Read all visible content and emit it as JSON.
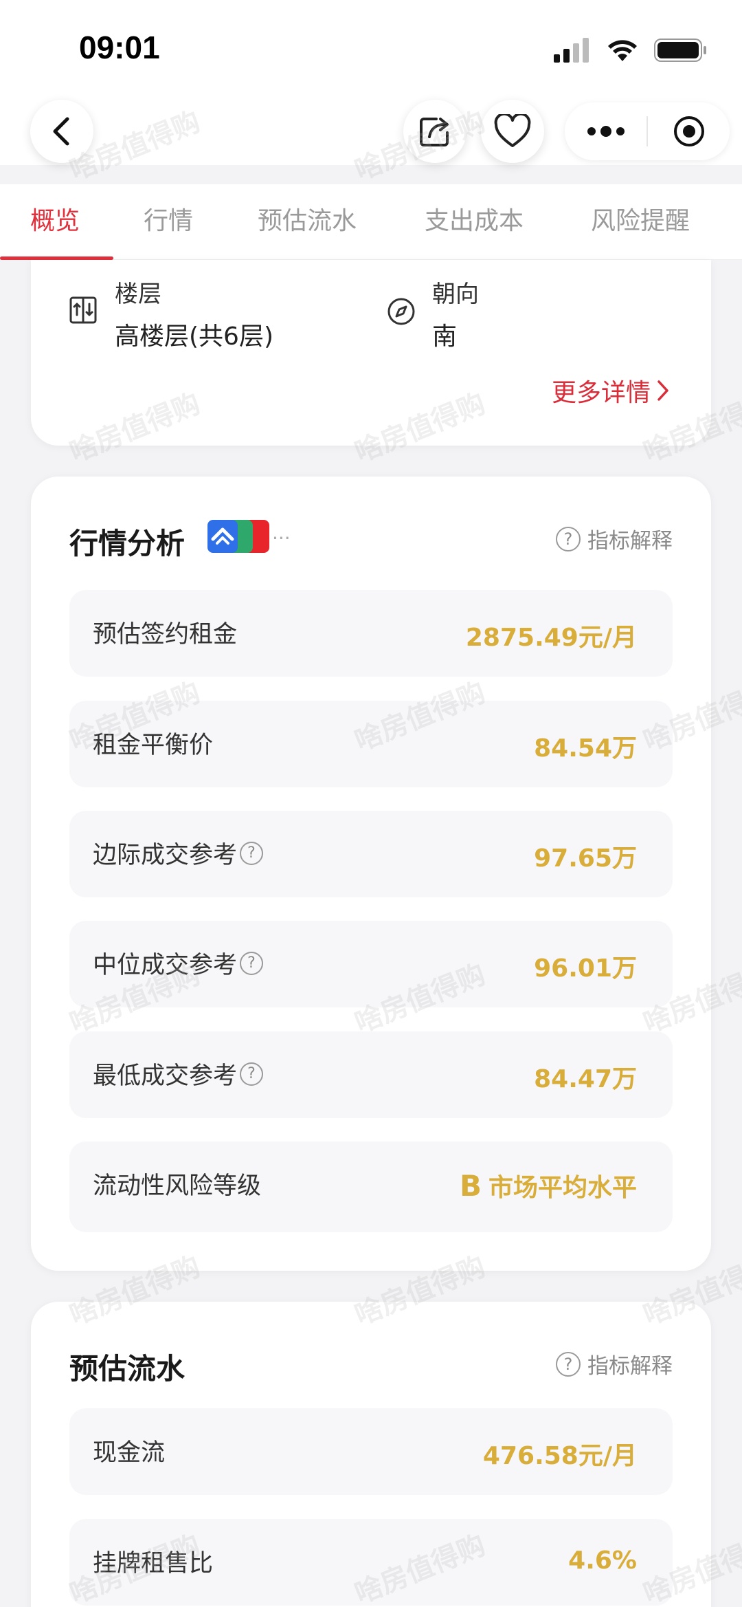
{
  "status_bar": {
    "time": "09:01"
  },
  "nav": {
    "back_icon": "chevron-left-icon",
    "share_icon": "share-icon",
    "favorite_icon": "heart-icon",
    "more_icon": "more-dots-icon",
    "close_icon": "target-icon"
  },
  "tabs": [
    {
      "label": "概览",
      "active": true
    },
    {
      "label": "行情",
      "active": false
    },
    {
      "label": "预估流水",
      "active": false
    },
    {
      "label": "支出成本",
      "active": false
    },
    {
      "label": "风险提醒",
      "active": false
    }
  ],
  "property_info": {
    "floor_label": "楼层",
    "floor_value": "高楼层(共6层)",
    "orientation_label": "朝向",
    "orientation_value": "南",
    "more_details": "更多详情"
  },
  "market_analysis": {
    "title": "行情分析",
    "explain": "指标解释",
    "rows": [
      {
        "label": "预估签约租金",
        "value": "2875.49元/月",
        "has_help": false
      },
      {
        "label": "租金平衡价",
        "value": "84.54万",
        "has_help": false
      },
      {
        "label": "边际成交参考",
        "value": "97.65万",
        "has_help": true
      },
      {
        "label": "中位成交参考",
        "value": "96.01万",
        "has_help": true
      },
      {
        "label": "最低成交参考",
        "value": "84.47万",
        "has_help": true
      }
    ],
    "liquidity": {
      "label": "流动性风险等级",
      "grade": "B",
      "value": "市场平均水平"
    }
  },
  "estimated_flow": {
    "title": "预估流水",
    "explain": "指标解释",
    "rows": [
      {
        "label": "现金流",
        "value": "476.58元/月"
      },
      {
        "label": "挂牌租售比",
        "value": "4.6%"
      }
    ]
  },
  "watermark": "啥房值得购",
  "colors": {
    "accent_red": "#e0303c",
    "value_gold": "#d8ad3a",
    "background": "#f3f3f5"
  },
  "help_glyph": "?",
  "more_chevron": "›"
}
